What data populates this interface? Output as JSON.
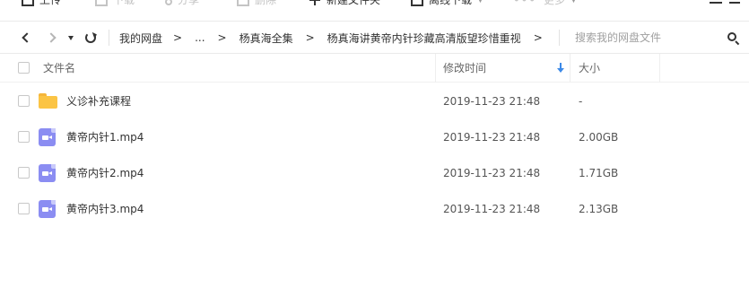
{
  "toolbar": {
    "upload": "上传",
    "download": "下载",
    "share": "分享",
    "delete": "删除",
    "new_folder": "新建文件夹",
    "offline_download": "离线下载",
    "more": "更多"
  },
  "address": {
    "crumbs": [
      "我的网盘",
      "...",
      "杨真海全集",
      "杨真海讲黄帝内针珍藏高清版望珍惜重视"
    ],
    "separator": ">",
    "search_placeholder": "搜索我的网盘文件"
  },
  "table": {
    "headers": {
      "name": "文件名",
      "modified": "修改时间",
      "size": "大小"
    },
    "rows": [
      {
        "type": "folder",
        "name": "义诊补充课程",
        "modified": "2019-11-23 21:48",
        "size": "-"
      },
      {
        "type": "video",
        "name": "黄帝内针1.mp4",
        "modified": "2019-11-23 21:48",
        "size": "2.00GB"
      },
      {
        "type": "video",
        "name": "黄帝内针2.mp4",
        "modified": "2019-11-23 21:48",
        "size": "1.71GB"
      },
      {
        "type": "video",
        "name": "黄帝内针3.mp4",
        "modified": "2019-11-23 21:48",
        "size": "2.13GB"
      }
    ]
  },
  "colors": {
    "folder": "#fbc444",
    "video": "#8b8df2",
    "sort_arrow": "#3d8ae8"
  }
}
